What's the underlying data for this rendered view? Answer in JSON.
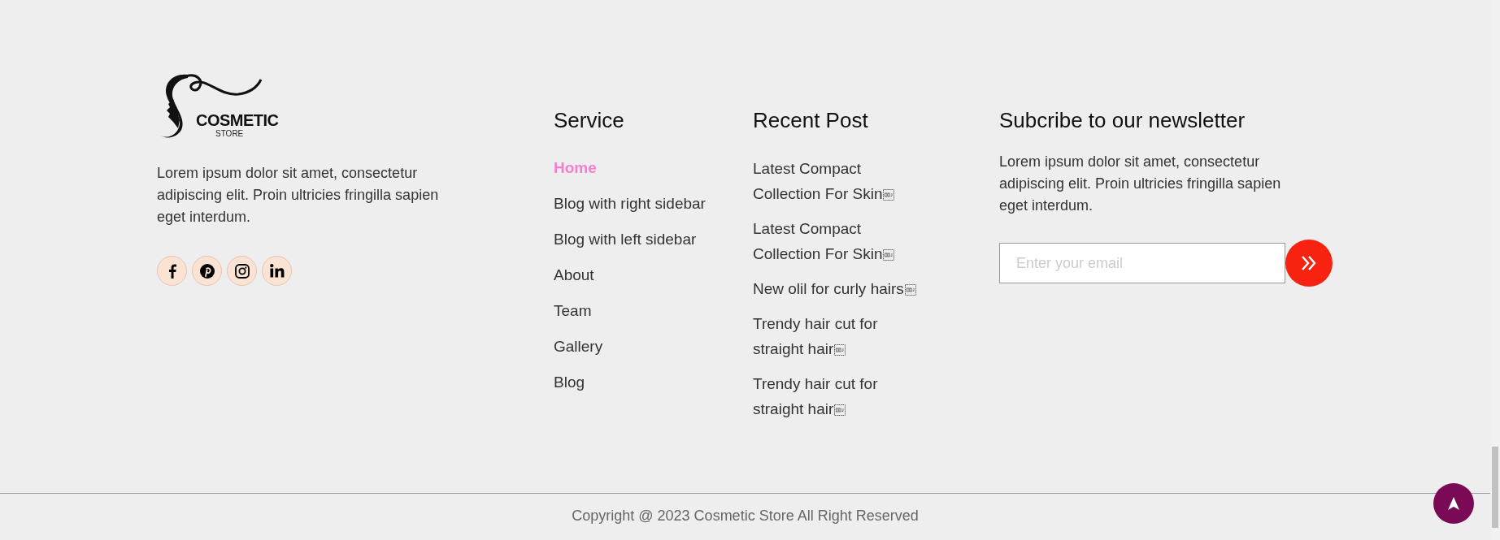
{
  "about": {
    "logo": {
      "name": "COSMETIC",
      "tagline": "STORE"
    },
    "text": "Lorem ipsum dolor sit amet, consectetur adipiscing elit. Proin ultricies fringilla sapien eget interdum.",
    "socials": [
      {
        "kind": "facebook"
      },
      {
        "kind": "pinterest"
      },
      {
        "kind": "instagram"
      },
      {
        "kind": "linkedin"
      }
    ]
  },
  "service": {
    "title": "Service",
    "items": [
      {
        "label": "Home",
        "selected": true
      },
      {
        "label": "Blog with right sidebar",
        "selected": false
      },
      {
        "label": "Blog with left sidebar",
        "selected": false
      },
      {
        "label": "About",
        "selected": false
      },
      {
        "label": "Team",
        "selected": false
      },
      {
        "label": "Gallery",
        "selected": false
      },
      {
        "label": "Blog",
        "selected": false
      }
    ]
  },
  "recent_post": {
    "title": "Recent Post",
    "items": [
      {
        "text": "Latest Compact Collection For Skin",
        "object_mark": true
      },
      {
        "text": "Latest Compact Collection For Skin",
        "object_mark": true
      },
      {
        "text": "New olil for curly hairs",
        "object_mark": true
      },
      {
        "text": "Trendy hair cut for straight hair",
        "object_mark": true
      },
      {
        "text": "Trendy hair cut for straight hair",
        "object_mark": true
      }
    ]
  },
  "newsletter": {
    "title": "Subcribe to our newsletter",
    "text": "Lorem ipsum dolor sit amet, consectetur adipiscing elit. Proin ultricies fringilla sapien eget interdum.",
    "placeholder": "Enter your email"
  },
  "copyright": "Copyright @ 2023 Cosmetic Store All Right Reserved"
}
